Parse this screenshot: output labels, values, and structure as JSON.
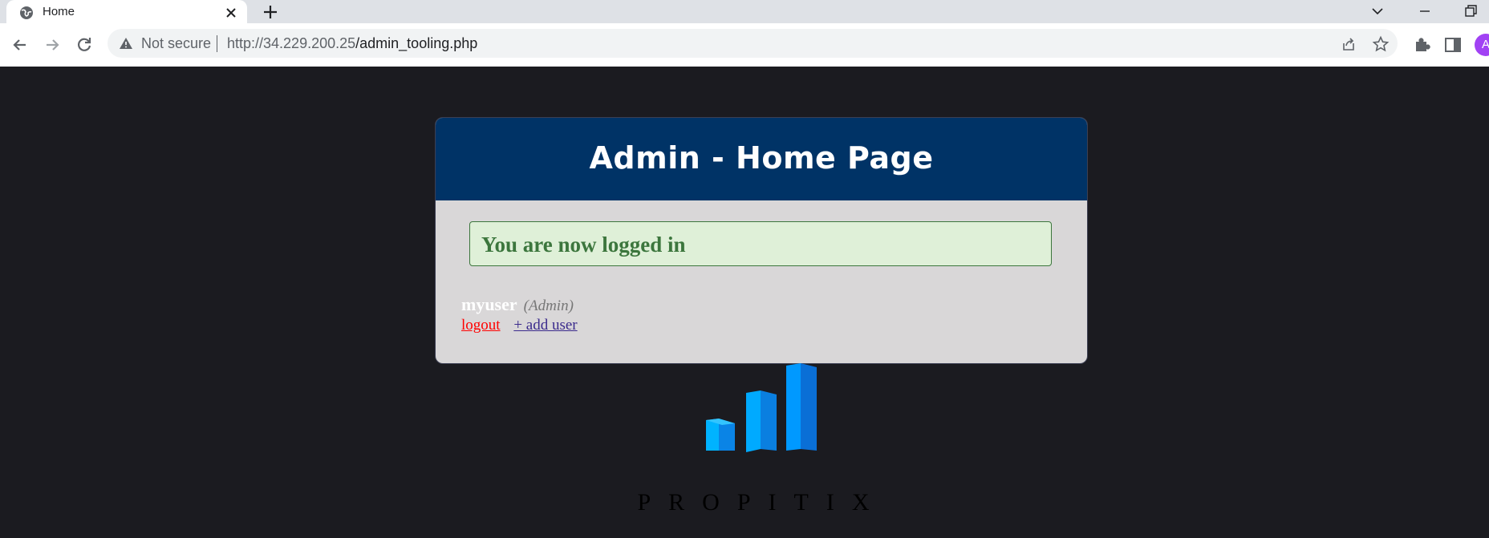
{
  "browser": {
    "tab_title": "Home",
    "security_label": "Not secure",
    "url_host": "http://34.229.200.25",
    "url_path": "/admin_tooling.php",
    "profile_initial": "A"
  },
  "page": {
    "heading": "Admin - Home Page",
    "success_message": "You are now logged in",
    "username": "myuser",
    "role": "(Admin)",
    "logout_label": "logout",
    "add_user_label": "+ add user",
    "brand_name": "PROPITIX"
  },
  "colors": {
    "header_bg": "#003366",
    "card_bg": "#d9d7d8",
    "success_bg": "#dff0d8",
    "success_text": "#3c763d",
    "page_bg": "#1b1b20",
    "logo_blue": "#0099ff"
  }
}
